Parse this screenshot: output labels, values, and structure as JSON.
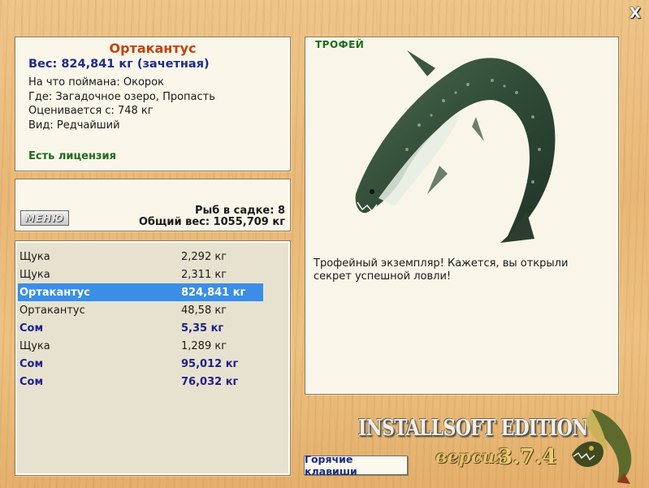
{
  "info": {
    "name": "Ортакантус",
    "weight": "Вес: 824,841 кг (зачетная)",
    "lines": [
      "На что поймана: Окорок",
      "Где: Загадочное озеро, Пропасть",
      "Оценивается с: 748 кг",
      "Вид: Редчайший"
    ],
    "license": "Есть лицензия"
  },
  "stats": {
    "menu_label": "МЕНЮ",
    "count": "Рыб в садке: 8",
    "total": "Общий вес: 1055,709 кг"
  },
  "catch": [
    {
      "name": "Щука",
      "weight": "2,292 кг",
      "state": "normal"
    },
    {
      "name": "Щука",
      "weight": "2,311 кг",
      "state": "normal"
    },
    {
      "name": "Ортакантус",
      "weight": "824,841 кг",
      "state": "selected"
    },
    {
      "name": "Ортакантус",
      "weight": "48,58 кг",
      "state": "normal"
    },
    {
      "name": "Сом",
      "weight": "5,35 кг",
      "state": "rare"
    },
    {
      "name": "Щука",
      "weight": "1,289 кг",
      "state": "normal"
    },
    {
      "name": "Сом",
      "weight": "95,012 кг",
      "state": "rare"
    },
    {
      "name": "Сом",
      "weight": "76,032 кг",
      "state": "rare"
    }
  ],
  "trophy": {
    "label": "ТРОФЕЙ",
    "description": "Трофейный экземпляр! Кажется, вы открыли секрет успешной ловли!"
  },
  "footer": {
    "hotkeys": "Горячие клавиши",
    "edition": "INSTALLSOFT EDITION",
    "version_word": "версия",
    "version_number": "3.7.4"
  },
  "close_label": "X",
  "colors": {
    "accent_name": "#c2410c",
    "weight_blue": "#1e2a8a",
    "license_green": "#1f6b1f",
    "selection": "#3a8ee6"
  }
}
